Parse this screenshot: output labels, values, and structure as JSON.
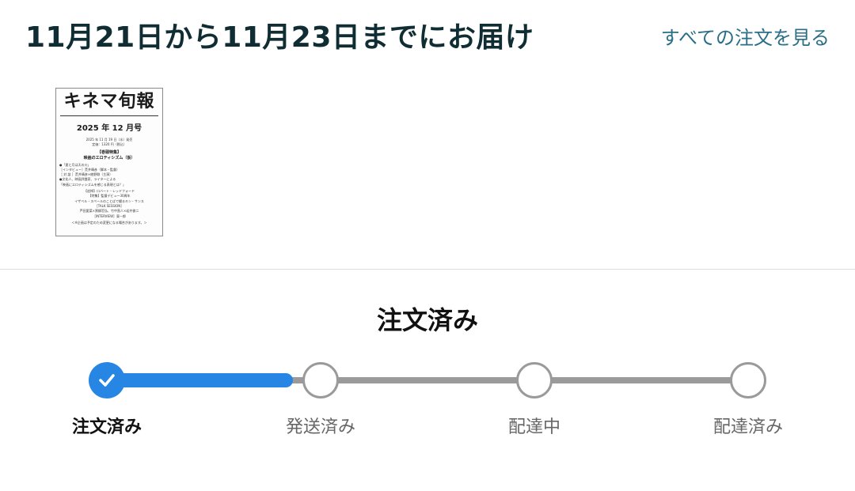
{
  "header": {
    "delivery_title": "11月21日から11月23日までにお届け",
    "all_orders_link": "すべての注文を見る"
  },
  "product": {
    "cover": {
      "masthead": "キネマ旬報",
      "issue": "2025 年 12 月号",
      "lines": [
        "2025 年 11 月 19 日（水）発売",
        "定価：1320 円（税込）",
        "【巻頭特集】",
        "映画のエロティシズム（仮）",
        "●「夏と月は天の川」",
        "［インタビュー］荒井晴彦（脚本・監督）",
        "［ 対 談 ］荒井晴彦×綾野剛（主演）",
        "●文化人、映画評論家、ライターによる",
        "「映画にエロティシズムを感じる表現とは？」",
        "【追悼】ロバート・レッドフォード",
        "【特集】監督デビュー30周年",
        "イザベル・スペールのことばで綴るキン・サンス",
        "［TALK SESSION］",
        "芦田愛菜×黒柳哲弘、竹中直人×岩井俊二",
        "［INTERVIEW］東一郎",
        "＜※企画は予定のため変更になる場合があります。＞"
      ]
    }
  },
  "status": {
    "heading": "注文済み",
    "progress_fraction": 0.29,
    "steps": [
      {
        "label": "注文済み",
        "state": "done"
      },
      {
        "label": "発送済み",
        "state": "pending"
      },
      {
        "label": "配達中",
        "state": "pending"
      },
      {
        "label": "配達済み",
        "state": "pending"
      }
    ]
  },
  "colors": {
    "title": "#0f2d33",
    "link": "#2a6f87",
    "progress_active": "#2786e3",
    "progress_inactive": "#9a9a9a"
  },
  "icons": {
    "done_step": "check-icon"
  }
}
